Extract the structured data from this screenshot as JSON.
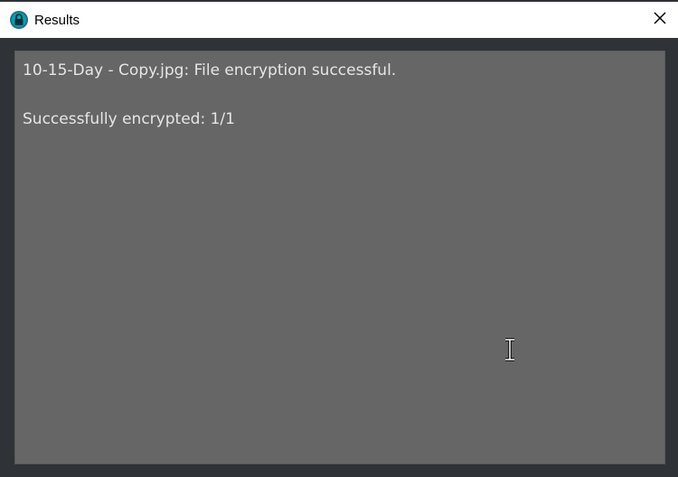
{
  "window": {
    "title": "Results",
    "icon": "lock-icon",
    "close_icon": "close-icon"
  },
  "output": {
    "lines": [
      "10-15-Day - Copy.jpg: File encryption successful.",
      "",
      "Successfully encrypted: 1/1"
    ]
  },
  "colors": {
    "titlebar_bg": "#ffffff",
    "window_bg": "#2f3337",
    "output_bg": "#666666",
    "output_text": "#e6e6e6",
    "icon_accent": "#00a3b4"
  }
}
